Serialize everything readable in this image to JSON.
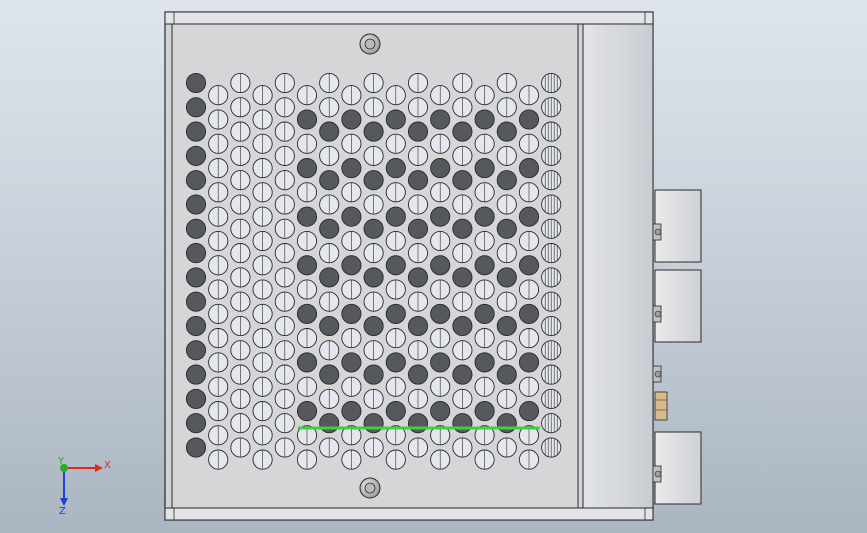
{
  "viewport": {
    "background_top": "#dfe5ec",
    "background_bottom": "#aab5c1",
    "edge_color": "#2a2a2a",
    "face_color": "#d6d6d8",
    "hole_dark": "#55585c",
    "hole_light": "#e4e8ee",
    "highlight_color": "#3fd03f"
  },
  "triad": {
    "x_label": "X",
    "y_label": "Y",
    "z_label": "Z",
    "x_color": "#e0281e",
    "y_color": "#21b021",
    "z_color": "#1f3fd6"
  },
  "model": {
    "view": "top",
    "part_type": "perforated enclosure with terminal blocks",
    "grid_columns": 17,
    "grid_rows": 16,
    "terminal_blocks": 3,
    "selected_edge_icon": "green-highlighted-edge"
  }
}
